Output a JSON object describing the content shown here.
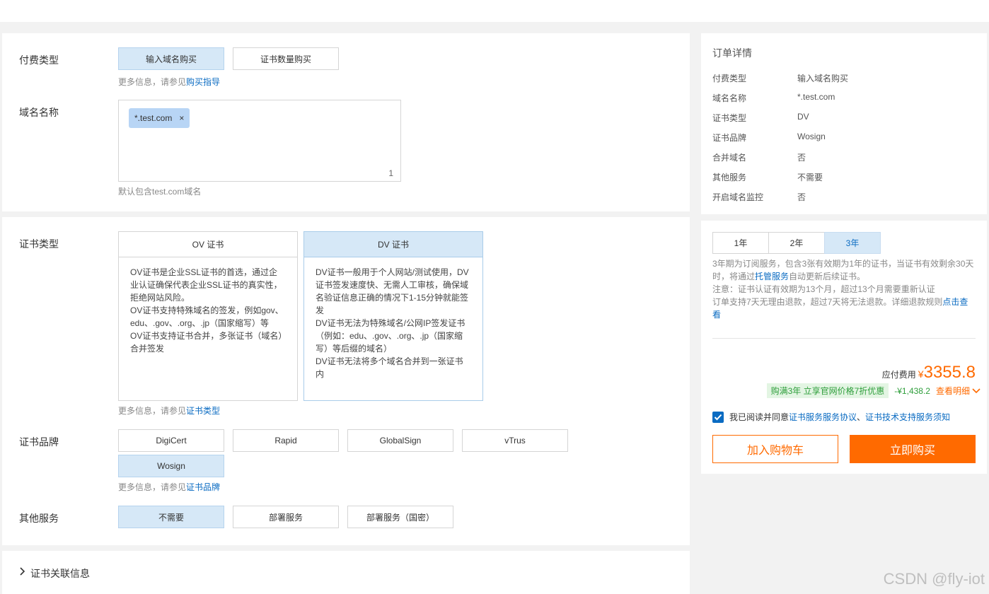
{
  "form": {
    "pay_type": {
      "label": "付费类型",
      "options": [
        "输入域名购买",
        "证书数量购买"
      ],
      "hint_prefix": "更多信息，请参见",
      "hint_link": "购买指导"
    },
    "domain": {
      "label": "域名名称",
      "tag": "*.test.com",
      "tag_close": "×",
      "count": "1",
      "hint": "默认包含test.com域名"
    },
    "cert_type": {
      "label": "证书类型",
      "ov_title": "OV 证书",
      "ov_lines": [
        "OV证书是企业SSL证书的首选，通过企业认证确保代表企业SSL证书的真实性，拒绝网站风险。",
        "OV证书支持特殊域名的签发，例如gov、edu、.gov、.org、.jp（国家缩写）等",
        "OV证书支持证书合并，多张证书（域名）合并签发"
      ],
      "dv_title": "DV 证书",
      "dv_lines": [
        "DV证书一般用于个人网站/测试使用，DV证书签发速度快、无需人工审核，确保域名验证信息正确的情况下1-15分钟就能签发",
        "DV证书无法为特殊域名/公网IP签发证书（例如：edu、.gov、.org、.jp（国家缩写）等后缀的域名）",
        "DV证书无法将多个域名合并到一张证书内"
      ],
      "hint_prefix": "更多信息，请参见",
      "hint_link": "证书类型"
    },
    "brand": {
      "label": "证书品牌",
      "options": [
        "DigiCert",
        "Rapid",
        "GlobalSign",
        "vTrus",
        "Wosign"
      ],
      "hint_prefix": "更多信息，请参见",
      "hint_link": "证书品牌"
    },
    "service": {
      "label": "其他服务",
      "options": [
        "不需要",
        "部署服务",
        "部署服务（国密）"
      ]
    },
    "related": {
      "label": "证书关联信息"
    }
  },
  "order": {
    "title": "订单详情",
    "rows": [
      {
        "k": "付费类型",
        "v": "输入域名购买"
      },
      {
        "k": "域名名称",
        "v": "*.test.com"
      },
      {
        "k": "证书类型",
        "v": "DV"
      },
      {
        "k": "证书品牌",
        "v": "Wosign"
      },
      {
        "k": "合并域名",
        "v": "否"
      },
      {
        "k": "其他服务",
        "v": "不需要"
      },
      {
        "k": "开启域名监控",
        "v": "否"
      }
    ]
  },
  "purchase": {
    "periods": [
      "1年",
      "2年",
      "3年"
    ],
    "note1_a": "3年期为订阅服务，包含3张有效期为1年的证书，当证书有效剩余30天时，将通过",
    "note1_link": "托管服务",
    "note1_b": "自动更新后续证书。",
    "note2": "注意：证书认证有效期为13个月，超过13个月需要重新认证",
    "note3_a": "订单支持7天无理由退款，超过7天将无法退款。详细退款规则",
    "note3_link": "点击查看",
    "price_label": "应付费用",
    "currency": "¥",
    "price": "3355.8",
    "promo": "购满3年 立享官网价格7折优惠",
    "discount": "-¥1,438.2",
    "detail_link": "查看明细",
    "agree_prefix": "我已阅读并同意",
    "agree_link1": "证书服务服务协议",
    "agree_sep": "、",
    "agree_link2": "证书技术支持服务须知",
    "cart_button": "加入购物车",
    "buy_button": "立即购买"
  },
  "watermark": "CSDN @fly-iot",
  "colors": {
    "accent": "#ff6a00",
    "link": "#0a6bc2",
    "selected_bg": "#d6e8f7",
    "promo_bg": "#e3f5e3",
    "promo_text": "#2e9e3b"
  }
}
